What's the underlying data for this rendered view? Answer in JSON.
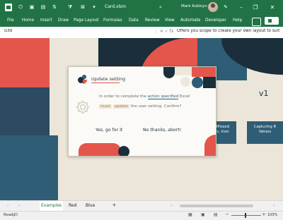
{
  "titlebar": {
    "filename": "Card.xlsm",
    "username": "Mark Kubisyn",
    "icons": [
      "excel-app-icon",
      "autosave-icon",
      "save-icon",
      "undo-icon",
      "redo-icon",
      "cell-style-icon",
      "sort-icon",
      "filter-icon",
      "share-lock-icon",
      "dropdown-icon",
      "search-icon",
      "pen-icon",
      "minimize-icon",
      "restore-icon",
      "close-icon"
    ]
  },
  "menu": [
    "File",
    "Home",
    "Insert",
    "Draw",
    "Page Layout",
    "Formulas",
    "Data",
    "Review",
    "View",
    "Automate",
    "Developer",
    "Help"
  ],
  "formulabar": {
    "namebox": "G39",
    "formula": "Offers you scope to create your own layout to suit"
  },
  "sheet": {
    "version_label": "v1",
    "button1": [
      "Missed",
      "s, Icon"
    ],
    "button2": [
      "Capturing R",
      "Values"
    ]
  },
  "dialog": {
    "title": "Update setting",
    "msg_prefix": "In order to complete the",
    "msg_highlight": "action specified",
    "msg_suffix": "Excel",
    "tag1": "must",
    "tag2": "update",
    "msg2_suffix": "the user setting. Confirm?",
    "yes": "Yes, go for it",
    "no": "No thanks, abort!"
  },
  "tabs": {
    "items": [
      "Examples",
      "Red",
      "Blue"
    ],
    "active": "Examples",
    "add": "+"
  },
  "status": {
    "ready": "Ready",
    "zoom": "100%"
  },
  "colors": {
    "excel_green": "#217346",
    "coral": "#e4564b",
    "navy": "#1b2e3c",
    "teal": "#2f5d75",
    "cream": "#ebe6d9"
  }
}
